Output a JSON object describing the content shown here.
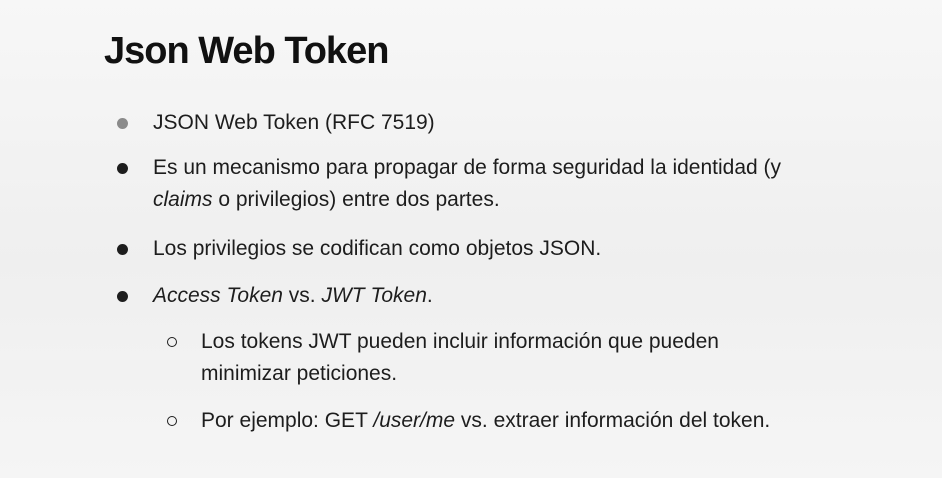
{
  "slide": {
    "title": "Json Web Token",
    "bullets": [
      {
        "level": 1,
        "marker": "dot-grey",
        "lines": [
          [
            {
              "text": "JSON Web Token (RFC 7519)",
              "italic": false
            }
          ]
        ]
      },
      {
        "level": 1,
        "marker": "dot",
        "lines": [
          [
            {
              "text": "Es un mecanismo para propagar de forma seguridad la identidad (y",
              "italic": false
            }
          ],
          [
            {
              "text": "claims",
              "italic": true
            },
            {
              "text": " o privilegios) entre dos partes.",
              "italic": false
            }
          ]
        ]
      },
      {
        "level": 1,
        "marker": "dot",
        "lines": [
          [
            {
              "text": "Los privilegios se codifican como objetos JSON.",
              "italic": false
            }
          ]
        ]
      },
      {
        "level": 1,
        "marker": "dot",
        "lines": [
          [
            {
              "text": "Access Token",
              "italic": true
            },
            {
              "text": " vs. ",
              "italic": false
            },
            {
              "text": "JWT Token",
              "italic": true
            },
            {
              "text": ".",
              "italic": false
            }
          ]
        ]
      },
      {
        "level": 2,
        "marker": "ring",
        "lines": [
          [
            {
              "text": "Los tokens JWT pueden incluir información que pueden",
              "italic": false
            }
          ],
          [
            {
              "text": "minimizar peticiones.",
              "italic": false
            }
          ]
        ]
      },
      {
        "level": 2,
        "marker": "ring",
        "lines": [
          [
            {
              "text": "Por ejemplo: GET ",
              "italic": false
            },
            {
              "text": "/user/me",
              "italic": true
            },
            {
              "text": " vs. extraer información del token.",
              "italic": false
            }
          ]
        ]
      }
    ]
  },
  "colors": {
    "text": "#1d1d1d",
    "title": "#111111",
    "first_bullet": "#8a8a8a"
  }
}
